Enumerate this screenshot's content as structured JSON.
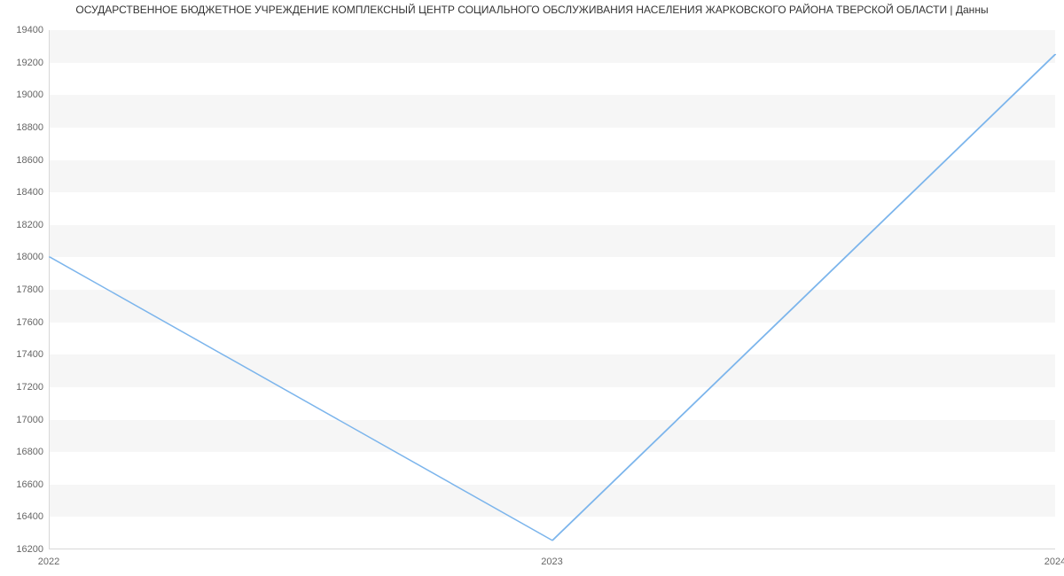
{
  "title": "ОСУДАРСТВЕННОЕ БЮДЖЕТНОЕ УЧРЕЖДЕНИЕ КОМПЛЕКСНЫЙ ЦЕНТР СОЦИАЛЬНОГО ОБСЛУЖИВАНИЯ НАСЕЛЕНИЯ ЖАРКОВСКОГО РАЙОНА ТВЕРСКОЙ ОБЛАСТИ | Данны",
  "chart_data": {
    "type": "line",
    "x": [
      2022,
      2023,
      2024
    ],
    "values": [
      18000,
      16250,
      19250
    ],
    "y_ticks": [
      16200,
      16400,
      16600,
      16800,
      17000,
      17200,
      17400,
      17600,
      17800,
      18000,
      18200,
      18400,
      18600,
      18800,
      19000,
      19200,
      19400
    ],
    "x_ticks": [
      2022,
      2023,
      2024
    ],
    "ylim": [
      16200,
      19400
    ],
    "xlim": [
      2022,
      2024
    ],
    "xlabel": "",
    "ylabel": "",
    "line_color": "#7cb5ec",
    "band_color": "#f6f6f6"
  }
}
